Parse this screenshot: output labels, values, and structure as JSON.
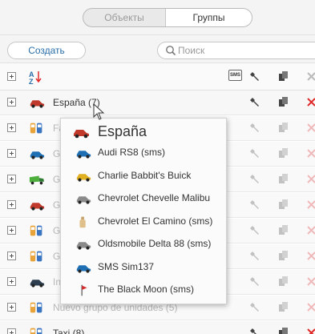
{
  "tabs": {
    "objects": "Объекты",
    "groups": "Группы",
    "active": "Группы"
  },
  "toolbar": {
    "create_label": "Создать",
    "search_placeholder": "Поиск"
  },
  "header": {
    "sort_label": "A↓Z",
    "sms_label": "SMS"
  },
  "groups": [
    {
      "label": "España (7)",
      "icon": "red-car-icon",
      "faded": false
    },
    {
      "label": "Fast",
      "icon": "people-icon",
      "faded": true
    },
    {
      "label": "G",
      "icon": "blue-car-icon",
      "faded": true
    },
    {
      "label": "Gr",
      "icon": "green-truck-icon",
      "faded": true
    },
    {
      "label": "Gr",
      "icon": "red-car-icon",
      "faded": true
    },
    {
      "label": "Grupo",
      "icon": "people-icon",
      "faded": true
    },
    {
      "label": "Grupo",
      "icon": "people-icon",
      "faded": true
    },
    {
      "label": "Inte",
      "icon": "car-icon",
      "faded": true
    },
    {
      "label": "Nuevo grupo de unidades (5)",
      "icon": "people-icon",
      "faded": true
    },
    {
      "label": "Taxi (8)",
      "icon": "people-icon",
      "faded": false
    }
  ],
  "popup": {
    "title": "España",
    "items": [
      {
        "label": "Audi RS8 (sms)",
        "icon": "blue-car-icon"
      },
      {
        "label": "Charlie Babbit's Buick",
        "icon": "yellow-car-icon"
      },
      {
        "label": "Chevrolet Chevelle Malibu",
        "icon": "grey-car-icon"
      },
      {
        "label": "Chevrolet El Camino (sms)",
        "icon": "bottle-icon"
      },
      {
        "label": "Oldsmobile Delta 88 (sms)",
        "icon": "grey-car-icon"
      },
      {
        "label": "SMS Sim137",
        "icon": "blue-car-icon"
      },
      {
        "label": "The Black Moon (sms)",
        "icon": "red-flag-icon"
      }
    ]
  },
  "colors": {
    "link": "#2a6ea8",
    "delete": "#e02b2b",
    "border": "#e2e2e2"
  }
}
